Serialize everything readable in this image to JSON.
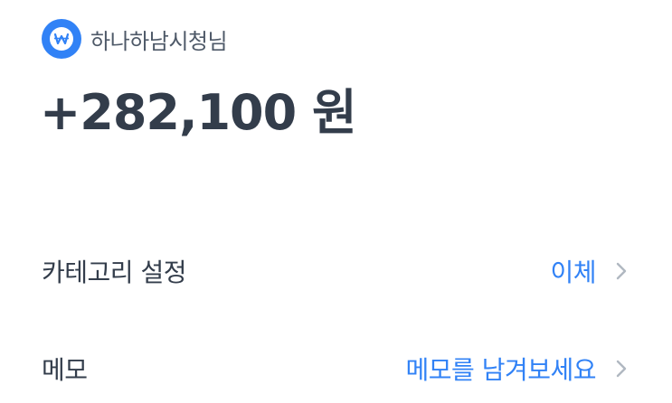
{
  "account": {
    "icon": "won-coin-icon",
    "name": "하나하남시청님"
  },
  "transaction": {
    "amount": "+282,100 원"
  },
  "rows": [
    {
      "label": "카테고리 설정",
      "value": "이체",
      "icon": "chevron-right-icon"
    },
    {
      "label": "메모",
      "value": "메모를 남겨보세요",
      "icon": "chevron-right-icon"
    }
  ],
  "colors": {
    "accent": "#3182f6",
    "text_primary": "#333d4b",
    "text_secondary": "#4e5968",
    "chevron": "#b0b8c1"
  }
}
